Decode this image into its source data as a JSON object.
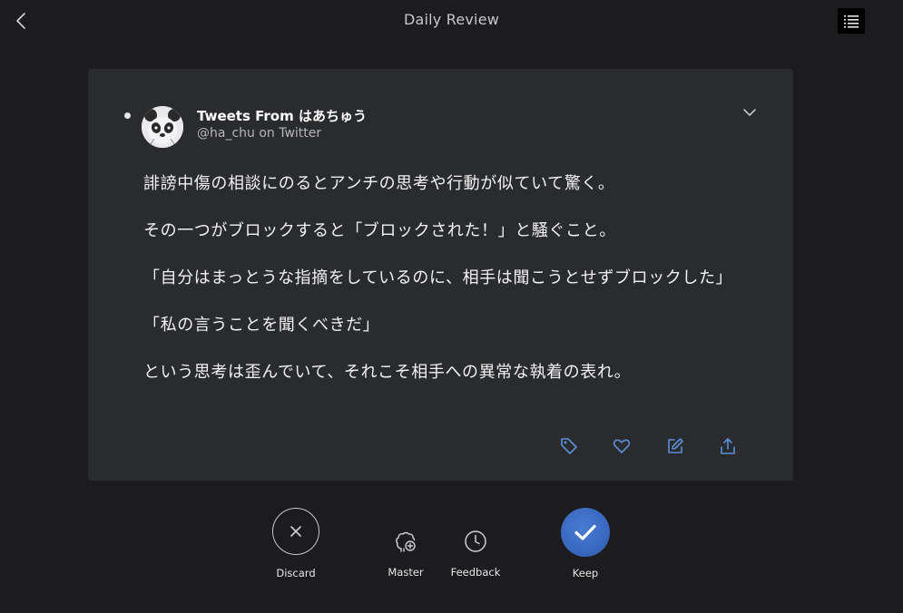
{
  "header": {
    "title": "Daily Review"
  },
  "card": {
    "author_name": "Tweets From はあちゅう",
    "author_handle": "@ha_chu on Twitter",
    "paragraphs": [
      "誹謗中傷の相談にのるとアンチの思考や行動が似ていて驚く。",
      "その一つがブロックすると「ブロックされた！」と騒ぐこと。",
      "「自分はまっとうな指摘をしているのに、相手は聞こうとせずブロックした」",
      "「私の言うことを聞くべきだ」",
      "という思考は歪んでいて、それこそ相手への異常な執着の表れ。"
    ],
    "actions": [
      "tag-icon",
      "heart-icon",
      "edit-icon",
      "share-icon"
    ]
  },
  "bottom": {
    "discard_label": "Discard",
    "master_label": "Master",
    "feedback_label": "Feedback",
    "keep_label": "Keep"
  },
  "colors": {
    "background": "#1c1c1e",
    "card": "#2a2b2f",
    "accent": "#3b6ac2",
    "icon_blue": "#5b8fd6"
  }
}
